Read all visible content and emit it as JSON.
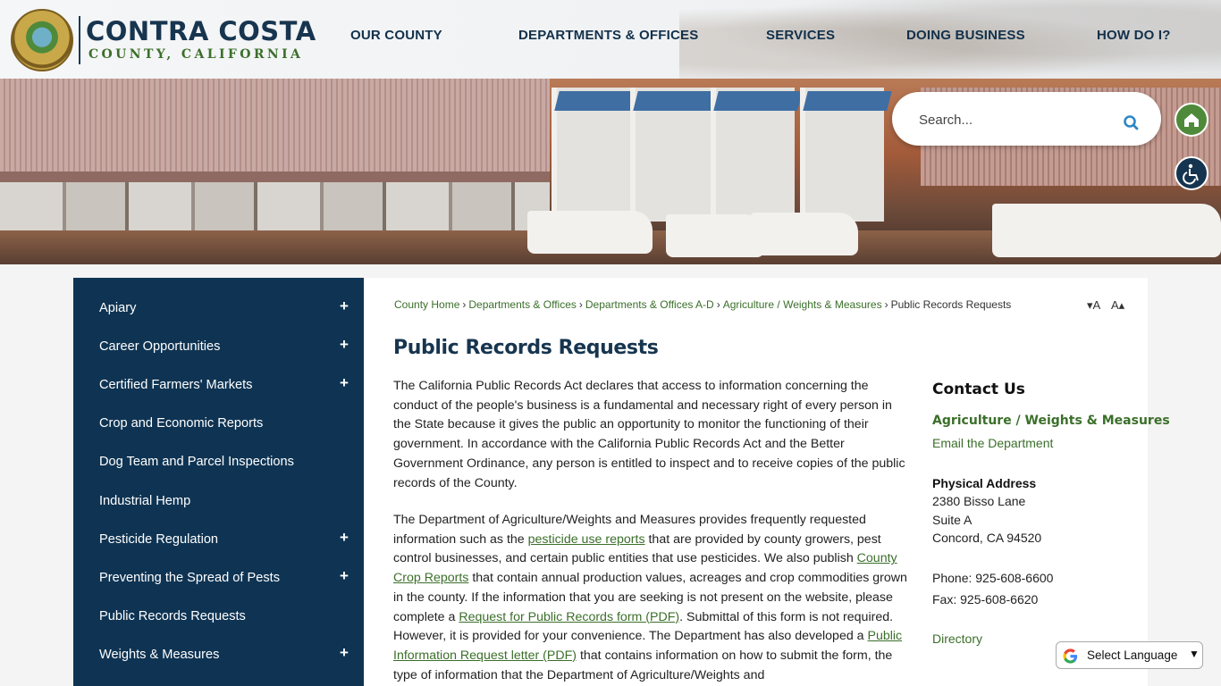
{
  "header": {
    "logo_title": "CONTRA COSTA",
    "logo_subtitle": "COUNTY, CALIFORNIA",
    "nav": [
      "OUR COUNTY",
      "DEPARTMENTS & OFFICES",
      "SERVICES",
      "DOING BUSINESS",
      "HOW DO I?"
    ]
  },
  "search": {
    "placeholder": "Search..."
  },
  "sidebar": {
    "items": [
      {
        "label": "Apiary",
        "expand": "+"
      },
      {
        "label": "Career Opportunities",
        "expand": "+"
      },
      {
        "label": "Certified Farmers' Markets",
        "expand": "+"
      },
      {
        "label": "Crop and Economic Reports",
        "expand": ""
      },
      {
        "label": "Dog Team and Parcel Inspections",
        "expand": ""
      },
      {
        "label": "Industrial Hemp",
        "expand": ""
      },
      {
        "label": "Pesticide Regulation",
        "expand": "+"
      },
      {
        "label": "Preventing the Spread of Pests",
        "expand": "+"
      },
      {
        "label": "Public Records Requests",
        "expand": ""
      },
      {
        "label": "Weights & Measures",
        "expand": "+"
      }
    ]
  },
  "breadcrumb": {
    "links": [
      "County Home",
      "Departments & Offices",
      "Departments & Offices A-D",
      "Agriculture / Weights & Measures"
    ],
    "current": "Public Records Requests",
    "separator": "›"
  },
  "font_controls": {
    "decrease": "▾A",
    "increase": "A▴"
  },
  "page": {
    "title": "Public Records Requests",
    "p1": "The California Public Records Act declares that access to information concerning the conduct of the people's business is a fundamental and necessary right of every person in the State because it gives the public an opportunity to monitor the functioning of their government. In accordance with the California Public Records Act and the Better Government Ordinance, any person is entitled to inspect and to receive copies of the public records of the County.",
    "p2": {
      "t1": "The Department of Agriculture/Weights and Measures provides frequently requested information such as the ",
      "link1": "pesticide use reports",
      "t2": " that are provided by county growers, pest control businesses, and certain public entities that use pesticides. We also publish ",
      "link2": "County Crop Reports",
      "t3": " that contain annual production values, acreages and crop commodities grown in the county. If the information that you are seeking is not present on the website, please complete a ",
      "link3": "Request for Public Records form (PDF)",
      "t4": ". Submittal of this form is not required. However, it is provided for your convenience. The Department has also developed a ",
      "link4": "Public Information Request letter (PDF)",
      "t5": " that contains information on how to submit the form, the type of information that the Department of Agriculture/Weights and"
    }
  },
  "contact": {
    "heading": "Contact Us",
    "department": "Agriculture / Weights & Measures",
    "email_link": "Email the Department",
    "address_label": "Physical Address",
    "address_lines": [
      "2380 Bisso Lane",
      "Suite A",
      "Concord, CA 94520"
    ],
    "phone": "Phone: 925-608-6600",
    "fax": "Fax: 925-608-6620",
    "directory_link": "Directory"
  },
  "translate": {
    "label": "Select Language"
  },
  "colors": {
    "navy": "#0f3453",
    "green": "#3b6f2a",
    "home_green": "#4e8a3a"
  }
}
